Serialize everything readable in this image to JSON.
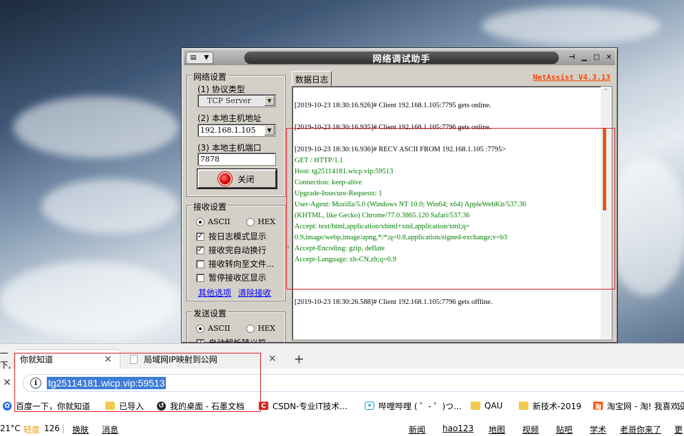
{
  "netassist": {
    "title": "网络调试助手",
    "version": "NetAssist V4.3.13",
    "net_settings": {
      "group_title": "网络设置",
      "protocol_label": "(1) 协议类型",
      "protocol_value": "TCP Server",
      "host_label": "(2) 本地主机地址",
      "host_value": "192.168.1.105",
      "port_label": "(3) 本地主机端口",
      "port_value": "7878",
      "close_button": "关闭"
    },
    "recv_settings": {
      "group_title": "接收设置",
      "ascii": "ASCII",
      "hex": "HEX",
      "options": [
        {
          "label": "按日志模式显示",
          "checked": true
        },
        {
          "label": "接收完自动换行",
          "checked": true
        },
        {
          "label": "接收转向至文件...",
          "checked": false
        },
        {
          "label": "暂停接收区显示",
          "checked": false
        }
      ],
      "more_options": "其他选项",
      "clear_recv": "清除接收"
    },
    "send_settings": {
      "group_title": "发送设置",
      "ascii": "ASCII",
      "hex": "HEX",
      "option_partial": "自动解析转义符"
    },
    "log_tab": "数据日志",
    "log": {
      "line1": "[2019-10-23 18:30:16.926]# Client 192.168.1.105:7795 gets online.",
      "line2": "[2019-10-23 18:30:16.935]# Client 192.168.1.105:7796 gets online.",
      "line3": "[2019-10-23 18:30:16.936]# RECV ASCII FROM 192.168.1.105 :7795>",
      "recv_lines": [
        "GET / HTTP/1.1",
        "Host: tg25114181.wicp.vip:59513",
        "Connection: keep-alive",
        "Upgrade-Insecure-Requests: 1",
        "User-Agent: Mozilla/5.0 (Windows NT 10.0; Win64; x64) AppleWebKit/537.36",
        "(KHTML, like Gecko) Chrome/77.0.3865.120 Safari/537.36",
        "Accept: text/html,application/xhtml+xml,application/xml;q=",
        "0.9,image/webp,image/apng,*/*;q=0.8,application/signed-exchange;v=b3",
        "Accept-Encoding: gzip, deflate",
        "Accept-Language: zh-CN,zh;q=0.9"
      ],
      "line4": "[2019-10-23 18:30:26.588]# Client 192.168.1.105:7796 gets offline."
    }
  },
  "browser": {
    "tab0_partial": "一下,",
    "tab1": "你就知道",
    "tab2": "局域网IP映射到公网",
    "url": "tg25114181.wicp.vip:59513",
    "bookmarks": [
      "百度一下，你就知道",
      "已导入",
      "我的桌面 - 石墨文档",
      "CSDN-专业IT技术...",
      "哔哩哔哩 ( ゜- ゜)つ...",
      "QAU",
      "新技术-2019",
      "淘宝网 - 淘! 我喜欢",
      "设"
    ],
    "status": {
      "temp": "21°C",
      "aqi_word": "轻度",
      "aqi_value": "126",
      "sep": "|",
      "skin": "换肤",
      "msg": "消息",
      "links": [
        "新闻",
        "hao123",
        "地图",
        "视频",
        "贴吧",
        "学术",
        "老哥你来了",
        "更"
      ]
    }
  },
  "colors": {
    "recv_text": "#008000",
    "version": "#ff4400",
    "highlight_box": "#e02020",
    "url_selection": "#3d7dd6"
  }
}
